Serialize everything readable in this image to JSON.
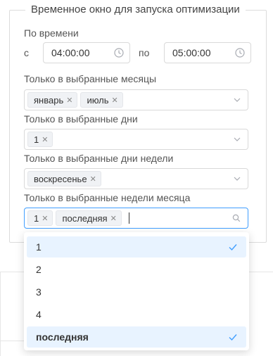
{
  "legend": "Временное окно для запуска оптимизации",
  "time": {
    "label": "По времени",
    "from_label": "с",
    "from_value": "04:00:00",
    "to_label": "по",
    "to_value": "05:00:00"
  },
  "months": {
    "label": "Только в выбранные месяцы",
    "tags": [
      "январь",
      "июль"
    ]
  },
  "days": {
    "label": "Только в выбранные дни",
    "tags": [
      "1"
    ]
  },
  "weekdays": {
    "label": "Только в выбранные дни недели",
    "tags": [
      "воскресенье"
    ]
  },
  "month_weeks": {
    "label": "Только в выбранные недели месяца",
    "tags": [
      "1",
      "последняя"
    ]
  },
  "dropdown": {
    "options": [
      {
        "label": "1",
        "selected": true
      },
      {
        "label": "2",
        "selected": false
      },
      {
        "label": "3",
        "selected": false
      },
      {
        "label": "4",
        "selected": false
      },
      {
        "label": "последняя",
        "selected": true
      }
    ]
  },
  "colors": {
    "accent": "#409eff",
    "selected_bg": "#e8f3ff"
  },
  "icons": {
    "time": "clock-icon",
    "select": "chevron-down-icon",
    "search": "search-icon",
    "remove": "close-icon",
    "selected": "check-icon"
  }
}
